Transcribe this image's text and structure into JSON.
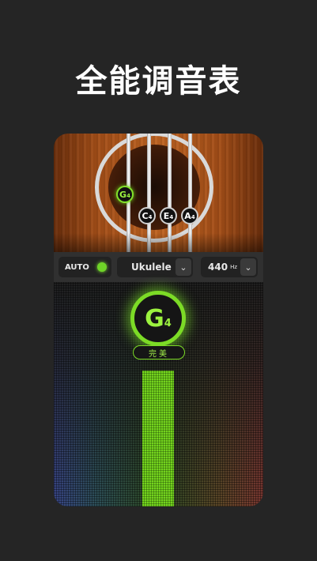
{
  "headline": "全能调音表",
  "strings": [
    {
      "letter": "G",
      "octave": "4",
      "active": true
    },
    {
      "letter": "C",
      "octave": "4",
      "active": false
    },
    {
      "letter": "E",
      "octave": "4",
      "active": false
    },
    {
      "letter": "A",
      "octave": "4",
      "active": false
    }
  ],
  "controls": {
    "auto_label": "AUTO",
    "auto_on": true,
    "instrument": "Ukulele",
    "frequency": "440",
    "frequency_unit": "Hz",
    "chevron": "⌄"
  },
  "tuner": {
    "note_letter": "G",
    "note_octave": "4",
    "status": "完美"
  },
  "colors": {
    "accent_green": "#7cdb26",
    "wood": "#b45a1e",
    "background": "#252525"
  },
  "icons": [
    "chevron-down-icon",
    "auto-indicator-icon"
  ]
}
